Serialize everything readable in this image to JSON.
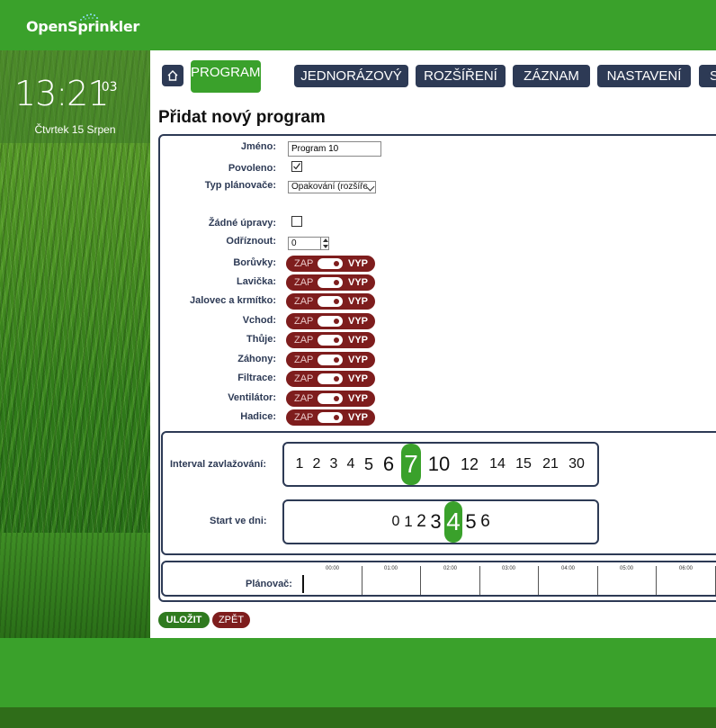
{
  "app": {
    "logo_text": "OpenSprinkler"
  },
  "clock": {
    "time": "13:21",
    "seconds": ":03",
    "date": "Čtvrtek 15 Srpen"
  },
  "nav": {
    "home_icon": "home-icon",
    "tabs": [
      {
        "label": "PROGRAMY",
        "active": true
      },
      {
        "label": "JEDNORÁZOVÝ"
      },
      {
        "label": "ROZŠÍŘENÍ"
      },
      {
        "label": "ZÁZNAM"
      },
      {
        "label": "NASTAVENÍ"
      },
      {
        "label": "S"
      }
    ]
  },
  "page": {
    "title": "Přidat nový program"
  },
  "form": {
    "name_label": "Jméno:",
    "name_value": "Program 10",
    "enabled_label": "Povoleno:",
    "enabled": true,
    "schedule_type_label": "Typ plánovače:",
    "schedule_type_value": "Opakování (rozšíře",
    "no_changes_label": "Žádné úpravy:",
    "no_changes": false,
    "cutoff_label": "Odříznout:",
    "cutoff_value": "0"
  },
  "toggle_labels": {
    "on": "ZAP",
    "off": "VYP"
  },
  "stations": [
    {
      "label": "Borůvky:"
    },
    {
      "label": "Lavička:"
    },
    {
      "label": "Jalovec a krmítko:"
    },
    {
      "label": "Vchod:"
    },
    {
      "label": "Thůje:"
    },
    {
      "label": "Záhony:"
    },
    {
      "label": "Filtrace:"
    },
    {
      "label": "Ventilátor:"
    },
    {
      "label": "Hadice:"
    }
  ],
  "interval": {
    "label": "Interval zavlažování:",
    "options": [
      "1",
      "2",
      "3",
      "4",
      "5",
      "6",
      "7",
      "10",
      "12",
      "14",
      "15",
      "21",
      "30"
    ],
    "selected": "7"
  },
  "start_day": {
    "label": "Start ve dni:",
    "options": [
      "0",
      "1",
      "2",
      "3",
      "4",
      "5",
      "6"
    ],
    "selected": "4"
  },
  "scheduler": {
    "label": "Plánovač:",
    "hours": [
      "00:00",
      "01:00",
      "02:00",
      "03:00",
      "04:00",
      "05:00",
      "06:00"
    ]
  },
  "actions": {
    "save": "ULOŽIT",
    "back": "ZPĚT"
  },
  "colors": {
    "brand_green": "#3aa12b",
    "navy": "#2d3a55",
    "maroon": "#7e1d1d"
  }
}
